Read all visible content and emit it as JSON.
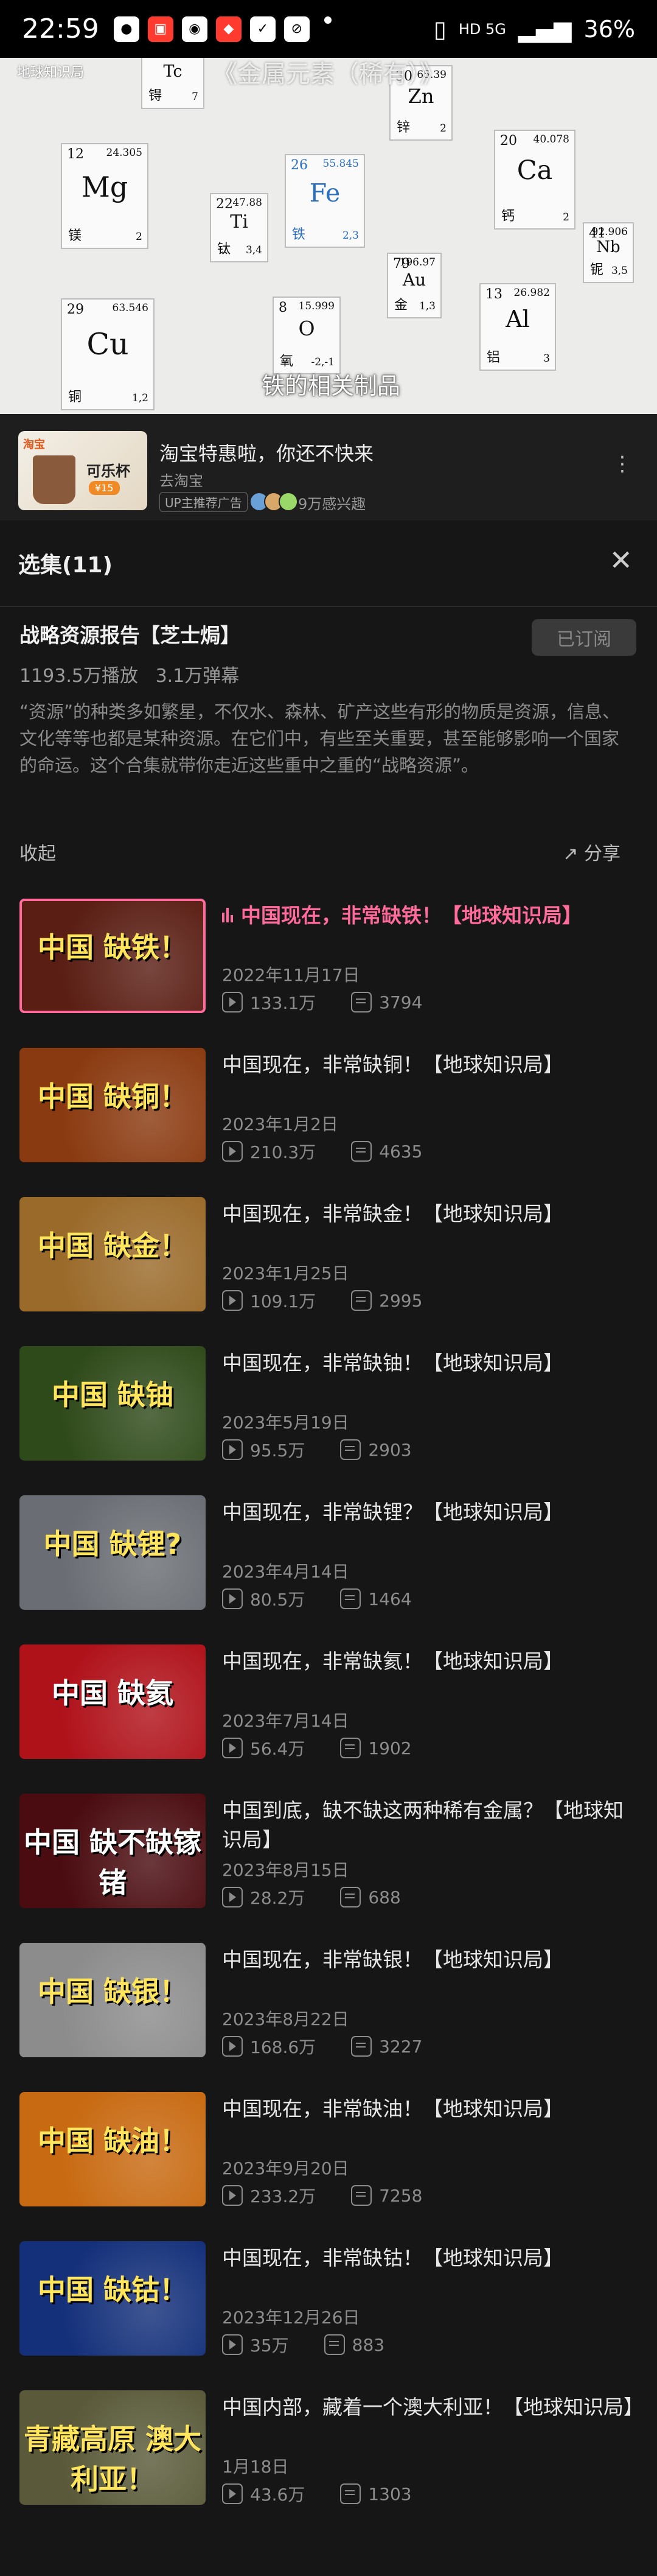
{
  "status_bar": {
    "time": "22:59",
    "notif_icons": [
      "chat-bubble-icon",
      "app-badge-icon",
      "bilibili-icon",
      "app-red-icon",
      "check-box-icon",
      "no-entry-icon"
    ],
    "signal": "HD 5G",
    "battery": "36%"
  },
  "video": {
    "watermark": "地球知识局",
    "top_caption": "《金属元素（稀有）》",
    "caption": "铁的相关制品",
    "elements": [
      {
        "num": "",
        "mass": "",
        "sym": "Tc",
        "cn": "锝",
        "ox": "7"
      },
      {
        "num": "30",
        "mass": "65.39",
        "sym": "Zn",
        "cn": "锌",
        "ox": "2"
      },
      {
        "num": "12",
        "mass": "24.305",
        "sym": "Mg",
        "cn": "镁",
        "ox": "2"
      },
      {
        "num": "22",
        "mass": "47.88",
        "sym": "Ti",
        "cn": "钛",
        "ox": "3,4"
      },
      {
        "num": "26",
        "mass": "55.845",
        "sym": "Fe",
        "cn": "铁",
        "ox": "2,3"
      },
      {
        "num": "20",
        "mass": "40.078",
        "sym": "Ca",
        "cn": "钙",
        "ox": "2"
      },
      {
        "num": "41",
        "mass": "92.906",
        "sym": "Nb",
        "cn": "铌",
        "ox": "3,5"
      },
      {
        "num": "79",
        "mass": "196.97",
        "sym": "Au",
        "cn": "金",
        "ox": "1,3"
      },
      {
        "num": "29",
        "mass": "63.546",
        "sym": "Cu",
        "cn": "铜",
        "ox": "1,2"
      },
      {
        "num": "8",
        "mass": "15.999",
        "sym": "O",
        "cn": "氧",
        "ox": "-2,-1"
      },
      {
        "num": "13",
        "mass": "26.982",
        "sym": "Al",
        "cn": "铝",
        "ox": "3"
      }
    ]
  },
  "ad": {
    "thumb_brand": "淘宝",
    "thumb_product": "可乐杯",
    "thumb_tag": "¥15",
    "title": "淘宝特惠啦，你还不快来",
    "source": "去淘宝",
    "badge": "UP主推荐广告",
    "interest": "9万感兴趣"
  },
  "panel": {
    "title": "选集(11)"
  },
  "series": {
    "title": "战略资源报告【芝士焗】",
    "subscribe_label": "已订阅",
    "plays": "1193.5万播放",
    "danmaku": "3.1万弹幕",
    "description": "“资源”的种类多如繁星，不仅水、森林、矿产这些有形的物质是资源，信息、文化等等也都是某种资源。在它们中，有些至关重要，甚至能够影响一个国家的命运。这个合集就带你走近这些重中之重的“战略资源”。",
    "collapse_label": "收起",
    "share_label": "分享"
  },
  "episodes": [
    {
      "title": "中国现在，非常缺铁！【地球知识局】",
      "date": "2022年11月17日",
      "plays": "133.1万",
      "danmaku": "3794",
      "thumb_text": "中国 缺铁！",
      "bg": "#5a1e14",
      "active": true
    },
    {
      "title": "中国现在，非常缺铜！【地球知识局】",
      "date": "2023年1月2日",
      "plays": "210.3万",
      "danmaku": "4635",
      "thumb_text": "中国 缺铜！",
      "bg": "#8a3a10"
    },
    {
      "title": "中国现在，非常缺金！【地球知识局】",
      "date": "2023年1月25日",
      "plays": "109.1万",
      "danmaku": "2995",
      "thumb_text": "中国 缺金！",
      "bg": "#9a6a2a"
    },
    {
      "title": "中国现在，非常缺铀！【地球知识局】",
      "date": "2023年5月19日",
      "plays": "95.5万",
      "danmaku": "2903",
      "thumb_text": "中国 缺铀",
      "bg": "#2f4a1a"
    },
    {
      "title": "中国现在，非常缺锂？【地球知识局】",
      "date": "2023年4月14日",
      "plays": "80.5万",
      "danmaku": "1464",
      "thumb_text": "中国 缺锂?",
      "bg": "#6a6e74"
    },
    {
      "title": "中国现在，非常缺氦！【地球知识局】",
      "date": "2023年7月14日",
      "plays": "56.4万",
      "danmaku": "1902",
      "thumb_text": "中国 缺氦",
      "bg": "#b0121a"
    },
    {
      "title": "中国到底，缺不缺这两种稀有金属？【地球知识局】",
      "date": "2023年8月15日",
      "plays": "28.2万",
      "danmaku": "688",
      "thumb_text": "中国 缺不缺镓锗",
      "bg": "#4a0c10"
    },
    {
      "title": "中国现在，非常缺银！【地球知识局】",
      "date": "2023年8月22日",
      "plays": "168.6万",
      "danmaku": "3227",
      "thumb_text": "中国 缺银！",
      "bg": "#8c8c8c"
    },
    {
      "title": "中国现在，非常缺油！【地球知识局】",
      "date": "2023年9月20日",
      "plays": "233.2万",
      "danmaku": "7258",
      "thumb_text": "中国 缺油！",
      "bg": "#c86a12"
    },
    {
      "title": "中国现在，非常缺钴！【地球知识局】",
      "date": "2023年12月26日",
      "plays": "35万",
      "danmaku": "883",
      "thumb_text": "中国 缺钴！",
      "bg": "#14307a"
    },
    {
      "title": "中国内部，藏着一个澳大利亚！【地球知识局】",
      "date": "1月18日",
      "plays": "43.6万",
      "danmaku": "1303",
      "thumb_text": "青藏高原 澳大利亚！",
      "bg": "#5a5a3a"
    }
  ]
}
